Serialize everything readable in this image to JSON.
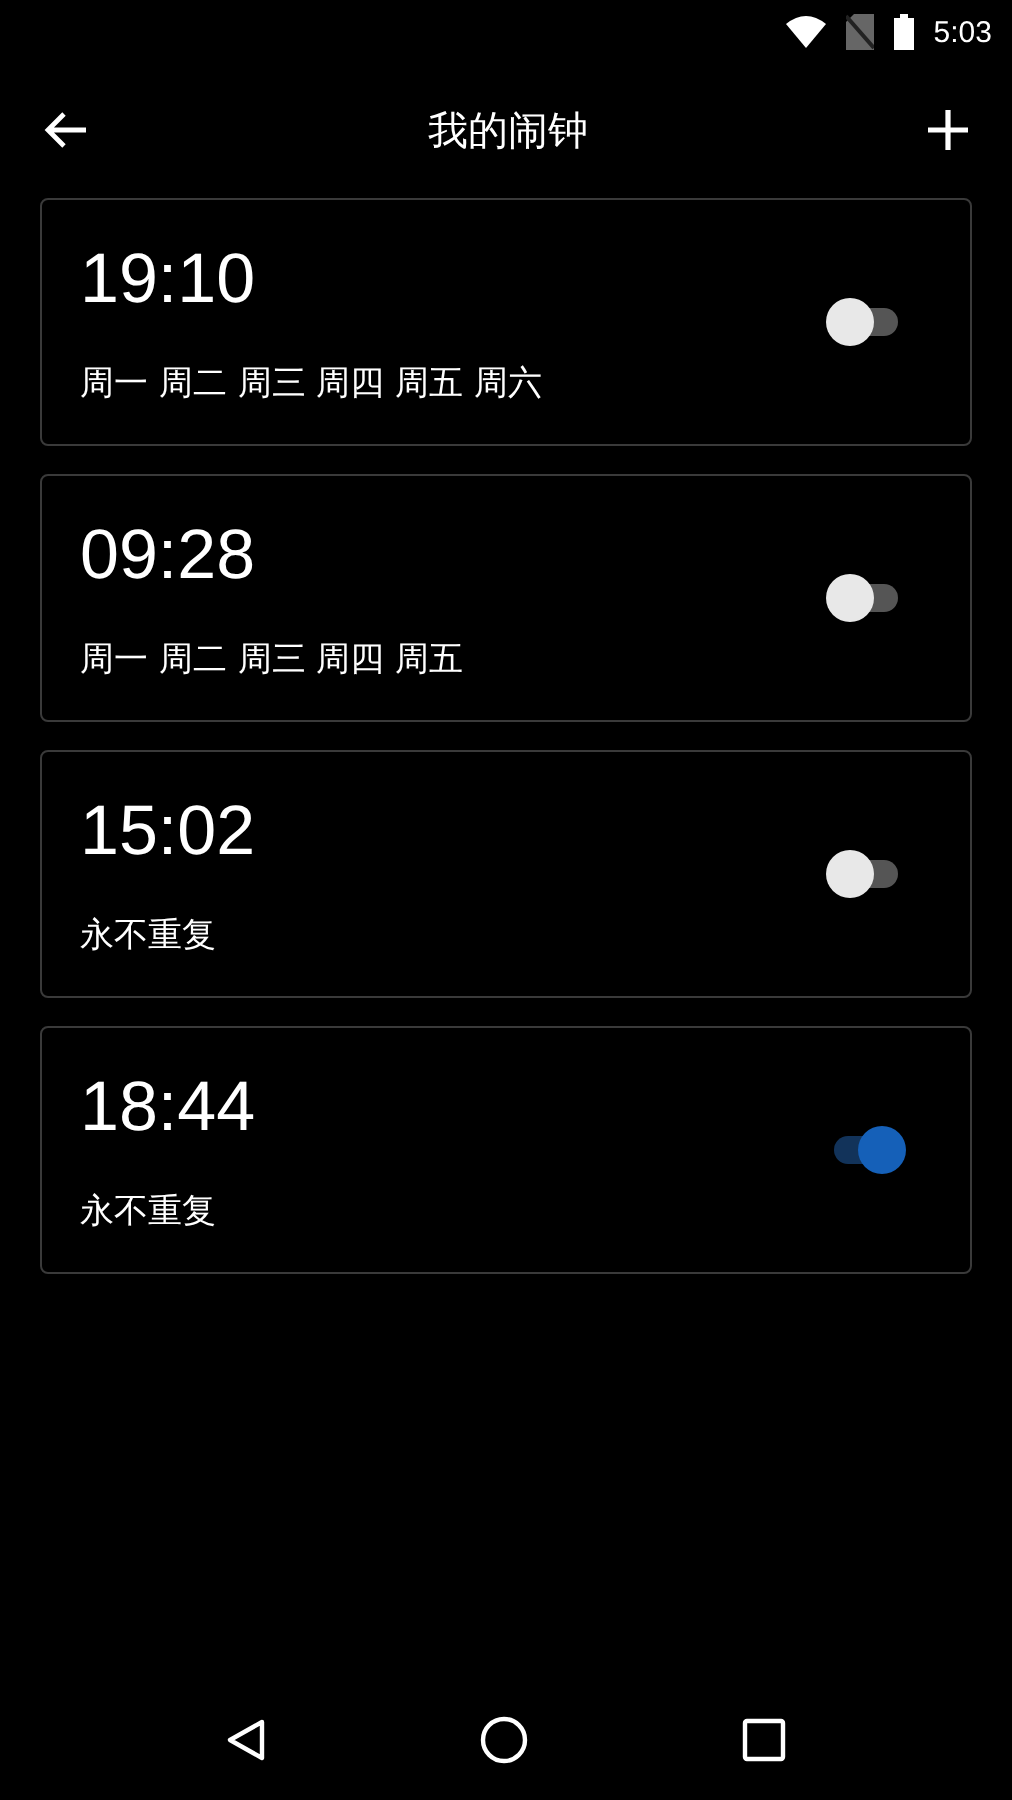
{
  "status_bar": {
    "time": "5:03"
  },
  "header": {
    "title": "我的闹钟"
  },
  "alarms": [
    {
      "time": "19:10",
      "repeat": "周一 周二 周三 周四 周五 周六",
      "on": false
    },
    {
      "time": "09:28",
      "repeat": "周一 周二 周三 周四 周五",
      "on": false
    },
    {
      "time": "15:02",
      "repeat": "永不重复",
      "on": false
    },
    {
      "time": "18:44",
      "repeat": "永不重复",
      "on": true
    }
  ]
}
